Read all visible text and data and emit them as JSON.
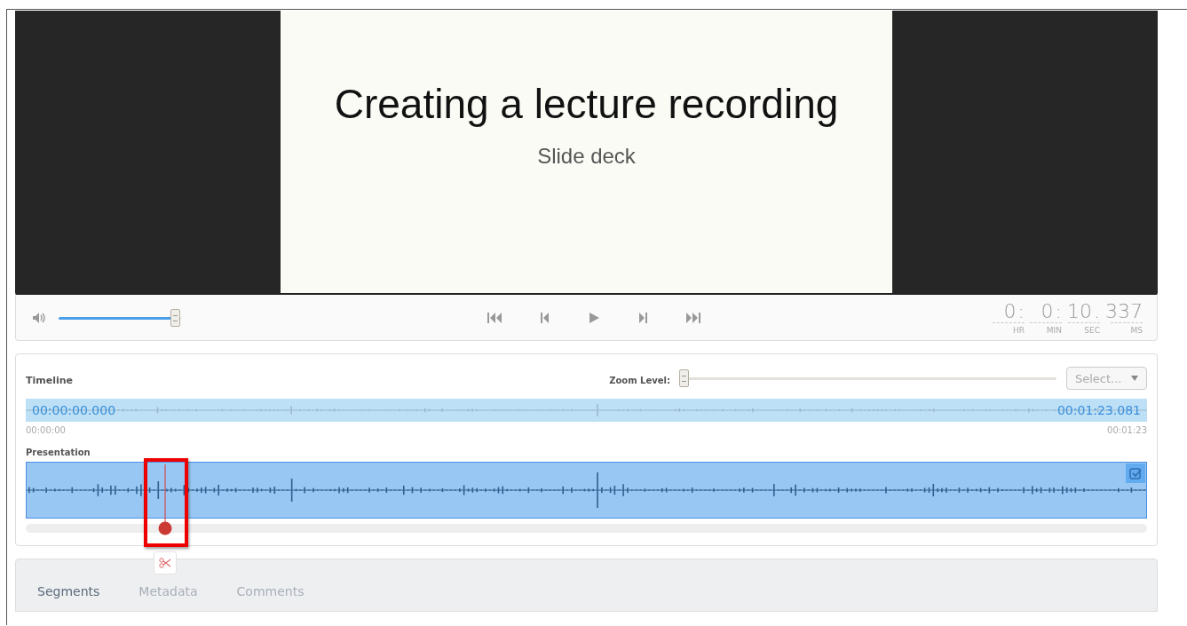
{
  "video": {
    "slide": {
      "title": "Creating a lecture recording",
      "subtitle": "Slide deck"
    }
  },
  "player": {
    "volume": {
      "level": 0.96
    },
    "transport": [
      {
        "kind": "first"
      },
      {
        "kind": "prev"
      },
      {
        "kind": "play"
      },
      {
        "kind": "next"
      },
      {
        "kind": "last"
      }
    ],
    "time": [
      {
        "value": "0",
        "sep": ":",
        "unit": "HR"
      },
      {
        "value": "0",
        "sep": ":",
        "unit": "MIN"
      },
      {
        "value": "10",
        "sep": ".",
        "unit": "SEC"
      },
      {
        "value": "337",
        "unit": "MS"
      }
    ]
  },
  "timeline": {
    "title": "Timeline",
    "zoom": {
      "label": "Zoom Level:",
      "level": 0
    },
    "select": {
      "placeholder": "Select..."
    },
    "overview": {
      "start": "00:00:00.000",
      "end": "00:01:23.081"
    },
    "ticks": [
      "00:00:00",
      "00:01:23"
    ],
    "tracks": [
      {
        "name": "Presentation",
        "checked": true
      }
    ],
    "playhead": {
      "level": 0.124
    }
  },
  "tabs": [
    {
      "label": "Segments",
      "selected": true
    },
    {
      "label": "Metadata",
      "selected": false
    },
    {
      "label": "Comments",
      "selected": false
    }
  ]
}
